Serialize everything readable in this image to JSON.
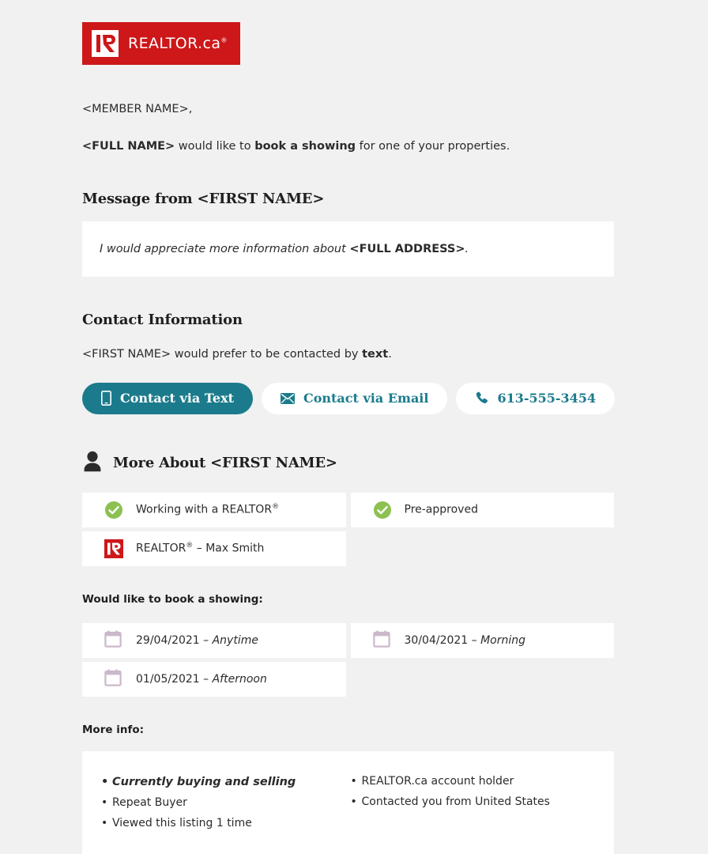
{
  "brand": {
    "logo_text": "REALTOR.ca",
    "logo_sup": "®",
    "logo_bg": "#cd1719",
    "accent_teal": "#1b7b8c",
    "check_green": "#8cc152",
    "calendar_mauve": "#cbb9cb",
    "page_bg": "#f1f1f1"
  },
  "body": {
    "greeting": "<MEMBER NAME>,",
    "lead_name": "<FULL NAME>",
    "lead_mid": " would like to ",
    "lead_action": "book a showing",
    "lead_tail": " for one of your properties."
  },
  "message": {
    "heading": "Message from <FIRST NAME>",
    "quote_lead": "I would appreciate more information about ",
    "quote_address": "<FULL ADDRESS>",
    "quote_tail": "."
  },
  "contact": {
    "heading": "Contact Information",
    "pref_lead": "<FIRST NAME> would prefer to be contacted by ",
    "pref_method": "text",
    "pref_tail": ".",
    "buttons": [
      {
        "label": "Contact via Text",
        "icon": "mobile-phone-icon",
        "style": "primary"
      },
      {
        "label": "Contact via Email",
        "icon": "envelope-icon",
        "style": "secondary"
      },
      {
        "label": "613-555-3454",
        "icon": "telephone-icon",
        "style": "secondary"
      }
    ]
  },
  "about": {
    "icon": "person-icon",
    "heading": "More About <FIRST NAME>",
    "cards": [
      {
        "icon": "green-check-icon",
        "text": "Working with a REALTOR",
        "sup": "®"
      },
      {
        "icon": "green-check-icon",
        "text": "Pre-approved",
        "sup": ""
      },
      {
        "icon": "realtor-r-icon",
        "text": "REALTOR",
        "sup": "®",
        "suffix": " – Max Smith"
      }
    ]
  },
  "showing": {
    "heading": "Would like to book a showing:",
    "slots": [
      {
        "icon": "calendar-icon",
        "date": "29/04/2021 – ",
        "when": "Anytime"
      },
      {
        "icon": "calendar-icon",
        "date": "30/04/2021 – ",
        "when": "Morning"
      },
      {
        "icon": "calendar-icon",
        "date": "01/05/2021 – ",
        "when": "Afternoon"
      }
    ]
  },
  "more_info": {
    "heading": "More info:",
    "left": [
      {
        "text": "Currently buying and selling",
        "emphasis": true
      },
      {
        "text": "Repeat Buyer",
        "emphasis": false
      },
      {
        "text": "Viewed this listing 1 time",
        "emphasis": false
      }
    ],
    "right": [
      {
        "text": "REALTOR.ca account holder",
        "emphasis": false
      },
      {
        "text": "Contacted you from United States",
        "emphasis": false
      }
    ]
  }
}
